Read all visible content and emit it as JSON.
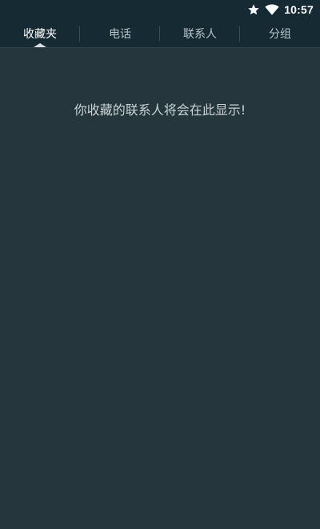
{
  "status_bar": {
    "time": "10:57",
    "icons": [
      "star-icon",
      "wifi-icon"
    ],
    "color": "#ffffff"
  },
  "tabs": [
    {
      "label": "收藏夹",
      "active": true
    },
    {
      "label": "电话",
      "active": false
    },
    {
      "label": "联系人",
      "active": false
    },
    {
      "label": "分组",
      "active": false
    }
  ],
  "main": {
    "empty_message": "你收藏的联系人将会在此显示!"
  },
  "colors": {
    "background": "#25363c",
    "bar": "#152a33",
    "active_text": "#ffffff",
    "inactive_text": "#b9c4c8"
  }
}
